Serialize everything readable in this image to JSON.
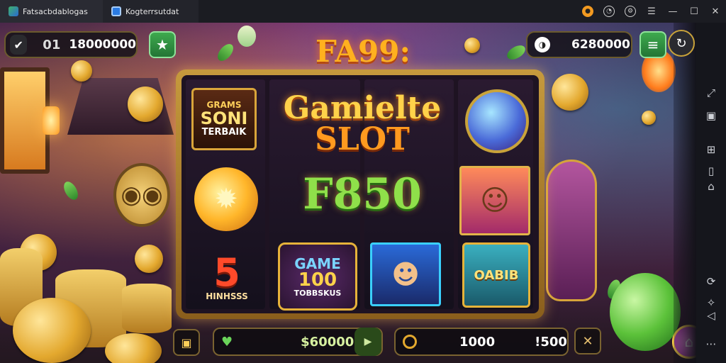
{
  "window": {
    "tabs": [
      {
        "label": "Fatsacbdablogas"
      },
      {
        "label": "Kogterrsutdat"
      }
    ],
    "controls": [
      "notification-icon",
      "account-icon",
      "settings-icon",
      "menu-icon",
      "minimize-icon",
      "maximize-icon",
      "close-icon"
    ]
  },
  "hud": {
    "left_balance_prefix": "01",
    "left_balance": "18000000",
    "right_balance": "6280000"
  },
  "game": {
    "logo": "FA99:",
    "title_line1": "Gamielte",
    "title_line2": "SLOT",
    "badge_line1": "GRAMS",
    "badge_line2": "SONI",
    "badge_line3": "TERBAIK",
    "mid_text": "F850",
    "five_num": "5",
    "five_label": "HINHSSS",
    "game_badge_line1": "GAME",
    "game_badge_line2": "100",
    "game_badge_line3": "TOBBSKUS",
    "bonus_badge": "OABIB"
  },
  "bottom": {
    "bet_value": "$60000",
    "win_value": "1000",
    "win_value2": "!500"
  },
  "colors": {
    "accent_gold": "#e8b340",
    "green_button": "#2f8f3f",
    "title_orange": "#ff9a1f"
  }
}
